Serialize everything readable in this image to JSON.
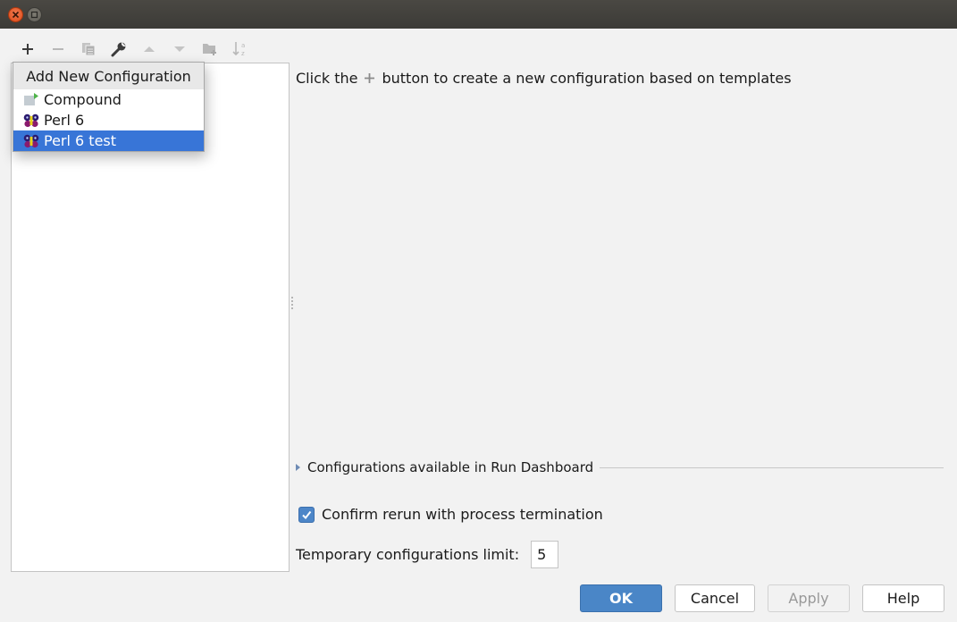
{
  "window": {
    "controls": [
      "close",
      "maximize"
    ]
  },
  "toolbar": {
    "items": [
      {
        "name": "add",
        "icon": "plus-icon",
        "enabled": true
      },
      {
        "name": "remove",
        "icon": "minus-icon",
        "enabled": false
      },
      {
        "name": "copy",
        "icon": "copy-icon",
        "enabled": false
      },
      {
        "name": "edit-defaults",
        "icon": "wrench-icon",
        "enabled": true
      },
      {
        "name": "move-up",
        "icon": "arrow-up-icon",
        "enabled": false
      },
      {
        "name": "move-down",
        "icon": "arrow-down-icon",
        "enabled": false
      },
      {
        "name": "new-folder",
        "icon": "folder-add-icon",
        "enabled": false
      },
      {
        "name": "sort",
        "icon": "sort-alpha-icon",
        "enabled": false
      }
    ]
  },
  "popup": {
    "title": "Add New Configuration",
    "items": [
      {
        "label": "Compound",
        "icon": "compound-folder-icon",
        "selected": false
      },
      {
        "label": "Perl 6",
        "icon": "butterfly-icon",
        "selected": false
      },
      {
        "label": "Perl 6 test",
        "icon": "butterfly-icon",
        "selected": true
      }
    ]
  },
  "main": {
    "hint_before": "Click the",
    "hint_after": "button to create a new configuration based on templates",
    "section_label": "Configurations available in Run Dashboard",
    "confirm_rerun_label": "Confirm rerun with process termination",
    "confirm_rerun_checked": true,
    "temp_limit_label": "Temporary configurations limit:",
    "temp_limit_value": "5"
  },
  "buttons": {
    "ok": "OK",
    "cancel": "Cancel",
    "apply": "Apply",
    "help": "Help"
  },
  "colors": {
    "accent": "#3875d7",
    "ok_button": "#4a86c7",
    "window_close": "#df4a16"
  }
}
